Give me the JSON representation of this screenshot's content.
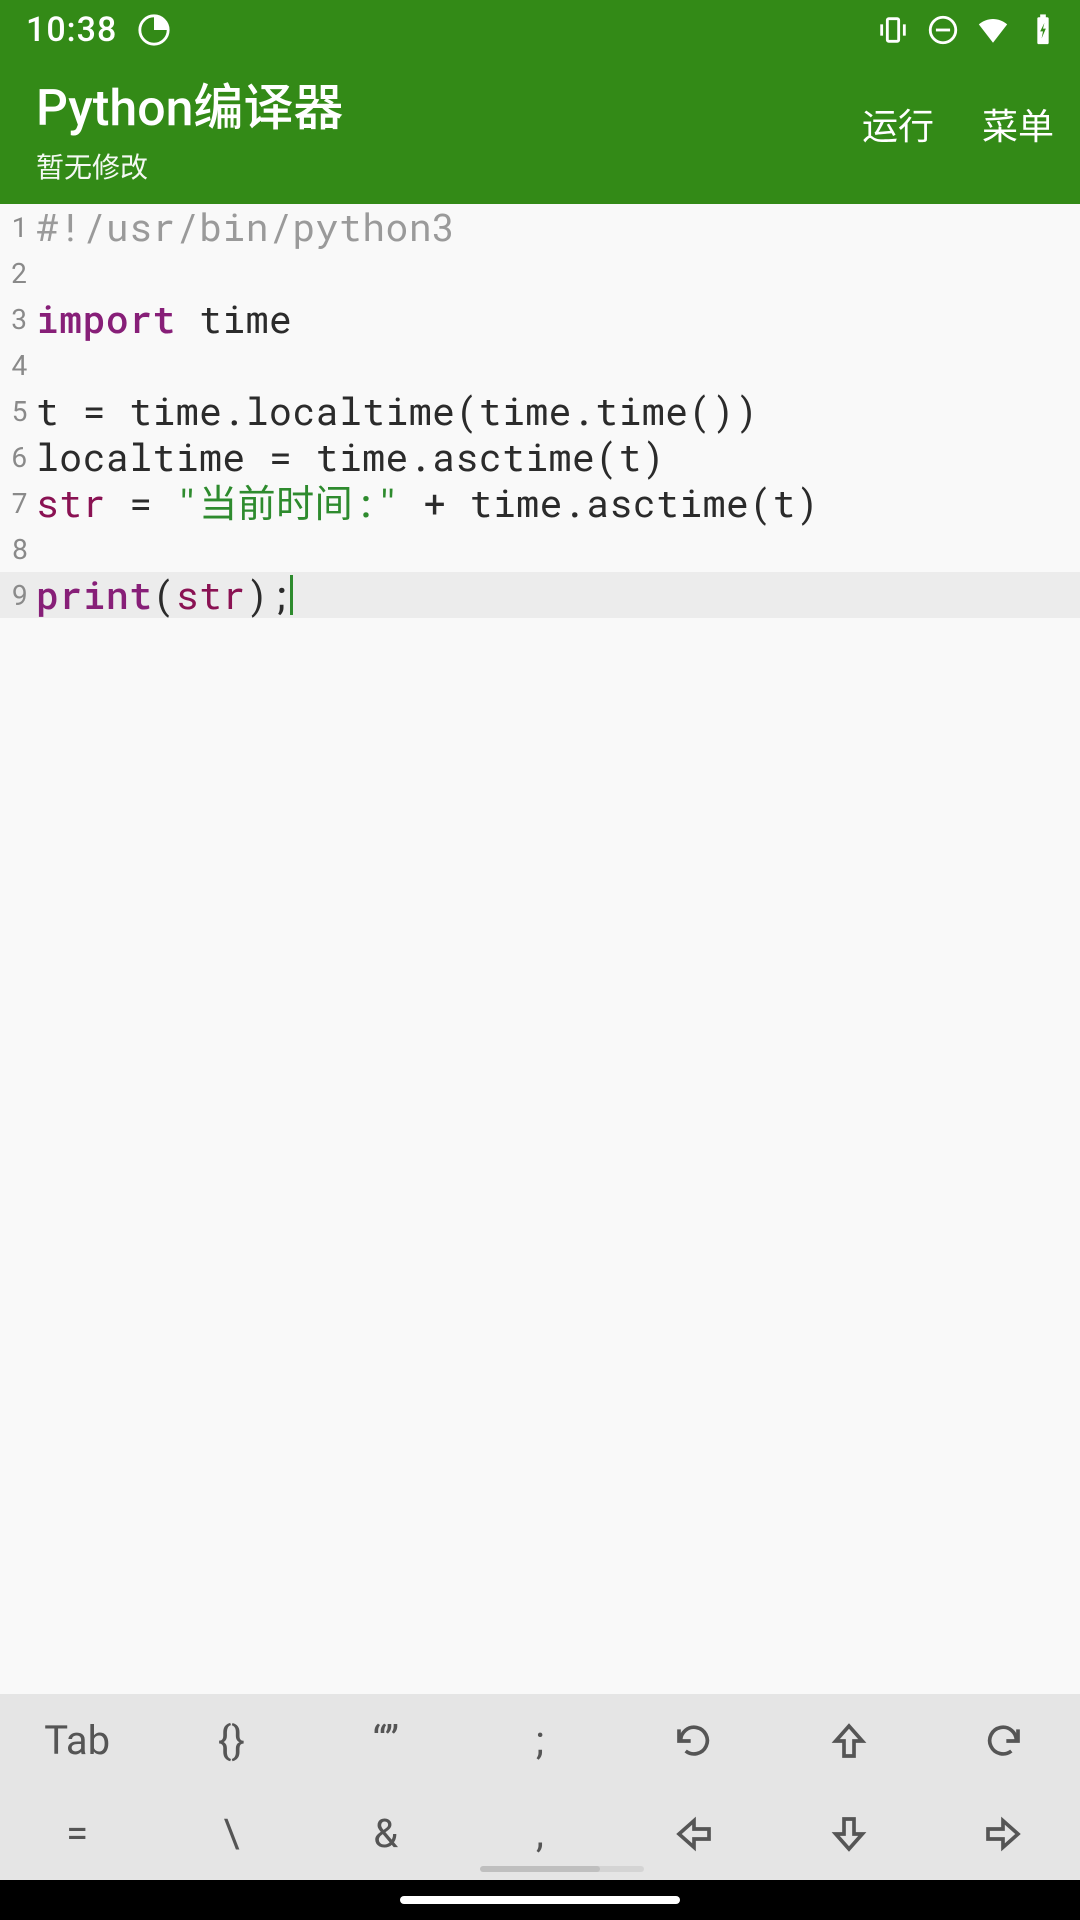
{
  "status": {
    "time": "10:38"
  },
  "header": {
    "title": "Python编译器",
    "subtitle": "暂无修改",
    "run": "运行",
    "menu": "菜单"
  },
  "code": {
    "lines": [
      {
        "n": "1",
        "current": false,
        "tokens": [
          {
            "cls": "tok-comment",
            "t": "#!/usr/bin/python3"
          }
        ]
      },
      {
        "n": "2",
        "current": false,
        "tokens": []
      },
      {
        "n": "3",
        "current": false,
        "tokens": [
          {
            "cls": "tok-keyword",
            "t": "import"
          },
          {
            "cls": "tok-default",
            "t": " time"
          }
        ]
      },
      {
        "n": "4",
        "current": false,
        "tokens": []
      },
      {
        "n": "5",
        "current": false,
        "tokens": [
          {
            "cls": "tok-default",
            "t": "t = time.localtime(time.time())"
          }
        ]
      },
      {
        "n": "6",
        "current": false,
        "tokens": [
          {
            "cls": "tok-default",
            "t": "localtime = time.asctime(t)"
          }
        ]
      },
      {
        "n": "7",
        "current": false,
        "tokens": [
          {
            "cls": "tok-builtin",
            "t": "str"
          },
          {
            "cls": "tok-default",
            "t": " = "
          },
          {
            "cls": "tok-string",
            "t": "\"当前时间:\""
          },
          {
            "cls": "tok-default",
            "t": " + time.asctime(t)"
          }
        ]
      },
      {
        "n": "8",
        "current": false,
        "tokens": []
      },
      {
        "n": "9",
        "current": true,
        "tokens": [
          {
            "cls": "tok-keyword",
            "t": "print"
          },
          {
            "cls": "tok-default",
            "t": "("
          },
          {
            "cls": "tok-builtin",
            "t": "str"
          },
          {
            "cls": "tok-default",
            "t": ");"
          }
        ],
        "cursor": true
      }
    ]
  },
  "keyboard": {
    "row1": [
      "Tab",
      "{}",
      "“”",
      ";",
      "undo-icon",
      "arrow-up-icon",
      "redo-icon"
    ],
    "row2": [
      "=",
      "\\",
      "&",
      ",",
      "arrow-left-icon",
      "arrow-down-icon",
      "arrow-right-icon"
    ]
  }
}
